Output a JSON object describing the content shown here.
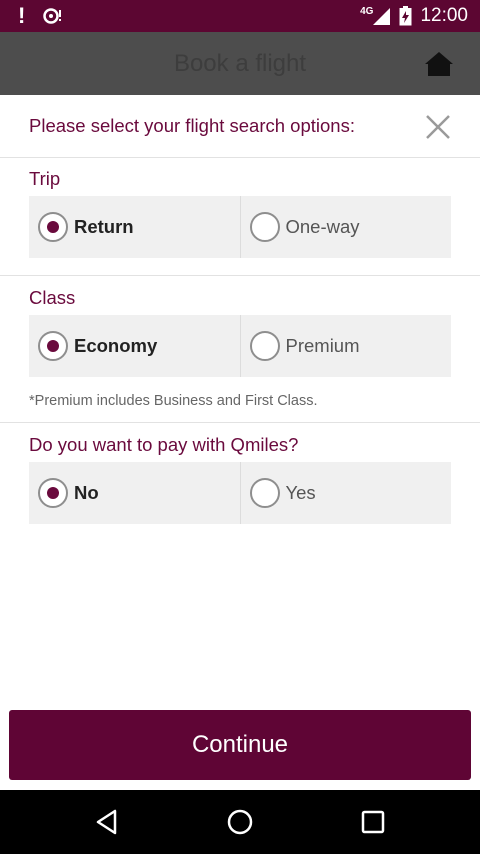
{
  "status_bar": {
    "notification_icon": "exclamation-icon",
    "network": "4G",
    "time": "12:00"
  },
  "app_bar": {
    "title": "Book a flight",
    "home_icon": "home-icon"
  },
  "sheet": {
    "title": "Please select your flight search options:",
    "close_icon": "close-icon"
  },
  "trip": {
    "label": "Trip",
    "options": [
      {
        "label": "Return",
        "selected": true
      },
      {
        "label": "One-way",
        "selected": false
      }
    ]
  },
  "class_section": {
    "label": "Class",
    "options": [
      {
        "label": "Economy",
        "selected": true
      },
      {
        "label": "Premium",
        "selected": false
      }
    ],
    "note": "*Premium includes Business and First Class."
  },
  "qmiles": {
    "label": "Do you want to pay with Qmiles?",
    "options": [
      {
        "label": "No",
        "selected": true
      },
      {
        "label": "Yes",
        "selected": false
      }
    ]
  },
  "continue_label": "Continue",
  "colors": {
    "status_bar": "#5c0632",
    "brand": "#6a0a3d",
    "button": "#5f0535",
    "app_bar": "#4d4d4d"
  }
}
